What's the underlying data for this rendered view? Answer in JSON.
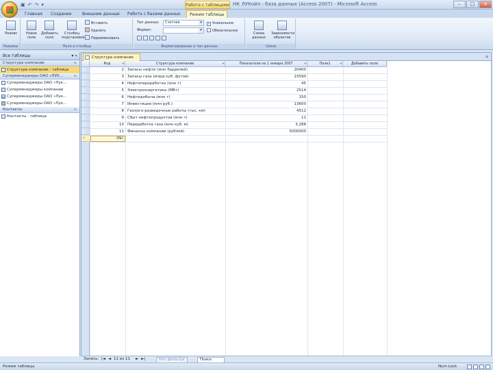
{
  "app": {
    "window_title": "НК ЛУКойл : база данных (Access 2007) - Microsoft Access",
    "context_tab_label": "Работа с таблицами"
  },
  "tabs": [
    {
      "label": "Главная"
    },
    {
      "label": "Создание"
    },
    {
      "label": "Внешние данные"
    },
    {
      "label": "Работа с базами данных"
    },
    {
      "label": "Режим таблицы"
    }
  ],
  "ribbon": {
    "views_group": {
      "label": "Режимы",
      "btn_view": "Режим"
    },
    "fields_group": {
      "label": "Поля и столбцы",
      "btn_new_field": "Новое поле",
      "btn_add_existing": "Добавить поля",
      "btn_lookup": "Столбец подстановок",
      "btn_insert": "Вставить",
      "btn_delete": "Удалить",
      "btn_rename": "Переименовать"
    },
    "format_group": {
      "label": "Форматирование и тип данных",
      "type_label": "Тип данных:",
      "type_value": "Счетчик",
      "format_label": "Формат:",
      "format_value": "",
      "chk_unique": "Уникальное",
      "chk_required": "Обязательное",
      "unique_checked": true,
      "required_checked": false
    },
    "relations_group": {
      "label": "Связи",
      "btn_relations": "Схема данных",
      "btn_dependencies": "Зависимости объектов"
    }
  },
  "nav": {
    "header": "Все таблицы",
    "sections": [
      {
        "title": "Структура компании",
        "items": [
          {
            "label": "Структура компании : таблица",
            "kind": "table",
            "selected": true
          }
        ]
      },
      {
        "title": "Суперменеджеры ОАО «ЛУК...",
        "items": [
          {
            "label": "Суперменеджеры ОАО «Лук...",
            "kind": "table",
            "selected": false
          },
          {
            "label": "Суперменеджеры компании",
            "kind": "query",
            "selected": false
          },
          {
            "label": "Суперменеджеры ОАО «Лук...",
            "kind": "form",
            "selected": false
          },
          {
            "label": "Суперменеджеры ОАО «Лук...",
            "kind": "report",
            "selected": false
          }
        ]
      },
      {
        "title": "Контакты",
        "items": [
          {
            "label": "Контакты : таблица",
            "kind": "table",
            "selected": false
          }
        ]
      }
    ]
  },
  "document": {
    "tab_label": "Структура компании",
    "columns": [
      {
        "label": "Код"
      },
      {
        "label": "Структура компании"
      },
      {
        "label": "Показатели на 1 января 2007"
      },
      {
        "label": "Поле1"
      },
      {
        "label": "Добавить поле"
      }
    ],
    "rows": [
      {
        "id": "2",
        "name": "Запасы нефти (млн баррелей)",
        "value": "20400",
        "field1": ""
      },
      {
        "id": "3",
        "name": "Запасы газа (млрд куб. футов)",
        "value": "23590",
        "field1": ""
      },
      {
        "id": "4",
        "name": "Нефтепереработка (млн т)",
        "value": "45",
        "field1": ""
      },
      {
        "id": "5",
        "name": "Электроэнергетика (МВт)",
        "value": "2514",
        "field1": ""
      },
      {
        "id": "6",
        "name": "Нефтедобыча (млн т)",
        "value": "150",
        "field1": ""
      },
      {
        "id": "7",
        "name": "Инвестиции (млн руб.)",
        "value": "13600",
        "field1": ""
      },
      {
        "id": "8",
        "name": "Геолого-разведочные работы (тыс. км)",
        "value": "4512",
        "field1": ""
      },
      {
        "id": "9",
        "name": "Сбыт нефтепродуктов (млн т)",
        "value": "11",
        "field1": ""
      },
      {
        "id": "10",
        "name": "Переработка газа (млн куб. м)",
        "value": "3,288",
        "field1": ""
      },
      {
        "id": "11",
        "name": "Финансы компании (рублей)",
        "value": "5000000",
        "field1": ""
      }
    ],
    "new_row_placeholder": "(№)"
  },
  "recnav": {
    "record_label": "Запись:",
    "first": "|◄",
    "prev": "◄",
    "position": "11 из 11",
    "next": "►",
    "last": "►|",
    "filter": "Нет фильтра",
    "search": "Поиск"
  },
  "status": {
    "left": "Режим таблицы",
    "right": "Num Lock"
  }
}
